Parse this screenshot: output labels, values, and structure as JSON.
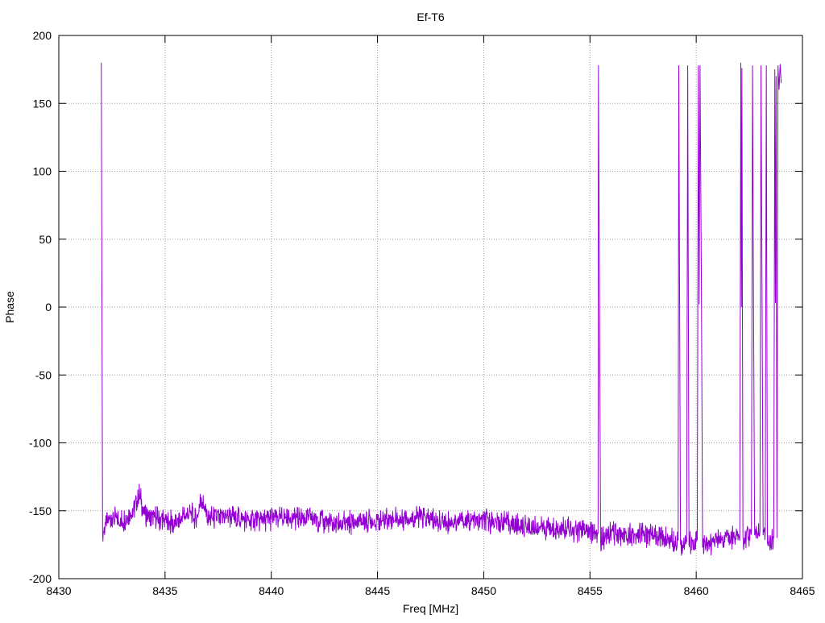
{
  "chart_data": {
    "type": "line",
    "title": "Ef-T6",
    "xlabel": "Freq [MHz]",
    "ylabel": "Phase",
    "xlim": [
      8430,
      8465
    ],
    "ylim": [
      -200,
      200
    ],
    "xticks": [
      8430,
      8435,
      8440,
      8445,
      8450,
      8455,
      8460,
      8465
    ],
    "yticks": [
      -200,
      -150,
      -100,
      -50,
      0,
      50,
      100,
      150,
      200
    ],
    "xtick_labels": [
      "8430",
      "8435",
      "8440",
      "8445",
      "8450",
      "8455",
      "8460",
      "8465"
    ],
    "ytick_labels": [
      "-200",
      "-150",
      "-100",
      "-50",
      "0",
      "50",
      "100",
      "150",
      "200"
    ],
    "grid": true,
    "legend": "none",
    "series": [
      {
        "color": "#9400d3",
        "x_range": [
          8432.0,
          8464.0
        ],
        "points": [
          [
            8432.0,
            180
          ],
          [
            8432.03,
            7
          ],
          [
            8432.06,
            -165
          ],
          [
            8432.2,
            -160
          ],
          [
            8432.5,
            -155
          ],
          [
            8433.0,
            -158
          ],
          [
            8433.5,
            -150
          ],
          [
            8433.8,
            -137
          ],
          [
            8434.0,
            -152
          ],
          [
            8434.5,
            -155
          ],
          [
            8435.0,
            -157
          ],
          [
            8435.5,
            -160
          ],
          [
            8436.0,
            -152
          ],
          [
            8436.5,
            -155
          ],
          [
            8436.7,
            -140
          ],
          [
            8437.0,
            -156
          ],
          [
            8438.0,
            -154
          ],
          [
            8439.0,
            -157
          ],
          [
            8440.0,
            -156
          ],
          [
            8441.0,
            -155
          ],
          [
            8442.0,
            -156
          ],
          [
            8443.0,
            -160
          ],
          [
            8444.0,
            -158
          ],
          [
            8445.0,
            -157
          ],
          [
            8446.0,
            -156
          ],
          [
            8447.0,
            -155
          ],
          [
            8448.0,
            -158
          ],
          [
            8449.0,
            -158
          ],
          [
            8450.0,
            -157
          ],
          [
            8451.0,
            -159
          ],
          [
            8452.0,
            -162
          ],
          [
            8453.0,
            -163
          ],
          [
            8454.0,
            -164
          ],
          [
            8455.0,
            -165
          ],
          [
            8455.38,
            -167
          ],
          [
            8455.4,
            178
          ],
          [
            8455.45,
            2
          ],
          [
            8455.5,
            -172
          ],
          [
            8456.0,
            -166
          ],
          [
            8457.0,
            -167
          ],
          [
            8458.0,
            -168
          ],
          [
            8459.0,
            -172
          ],
          [
            8459.15,
            -172
          ],
          [
            8459.18,
            178
          ],
          [
            8459.22,
            3
          ],
          [
            8459.26,
            -175
          ],
          [
            8459.55,
            -173
          ],
          [
            8459.6,
            178
          ],
          [
            8459.63,
            5
          ],
          [
            8459.66,
            -175
          ],
          [
            8460.05,
            -172
          ],
          [
            8460.1,
            178
          ],
          [
            8460.14,
            2
          ],
          [
            8460.18,
            178
          ],
          [
            8460.25,
            0
          ],
          [
            8460.3,
            -177
          ],
          [
            8461.0,
            -172
          ],
          [
            8462.0,
            -168
          ],
          [
            8462.05,
            -172
          ],
          [
            8462.1,
            180
          ],
          [
            8462.13,
            0
          ],
          [
            8462.15,
            176
          ],
          [
            8462.2,
            -170
          ],
          [
            8462.6,
            -166
          ],
          [
            8462.65,
            178
          ],
          [
            8462.7,
            -2
          ],
          [
            8462.75,
            -168
          ],
          [
            8463.0,
            -165
          ],
          [
            8463.05,
            178
          ],
          [
            8463.1,
            4
          ],
          [
            8463.15,
            -168
          ],
          [
            8463.25,
            -166
          ],
          [
            8463.3,
            178
          ],
          [
            8463.35,
            -173
          ],
          [
            8463.65,
            -170
          ],
          [
            8463.7,
            175
          ],
          [
            8463.73,
            3
          ],
          [
            8463.76,
            170
          ],
          [
            8463.8,
            -170
          ],
          [
            8463.85,
            178
          ],
          [
            8463.9,
            160
          ],
          [
            8463.95,
            179
          ],
          [
            8464.0,
            165
          ]
        ]
      }
    ]
  }
}
